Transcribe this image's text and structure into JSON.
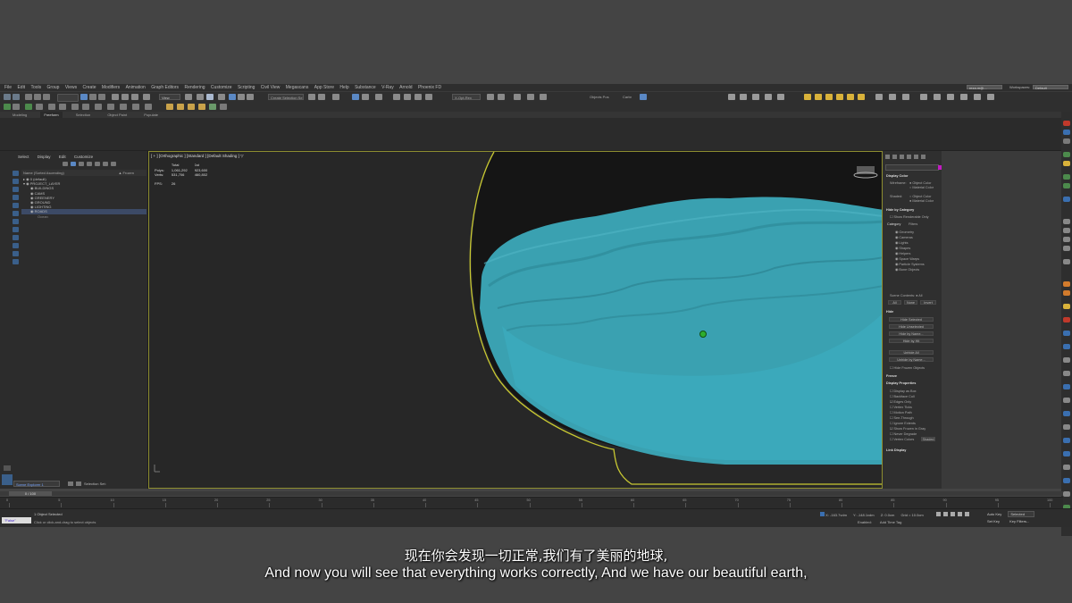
{
  "menu": [
    "File",
    "Edit",
    "Tools",
    "Group",
    "Views",
    "Create",
    "Modifiers",
    "Animation",
    "Graph Editors",
    "Rendering",
    "Customize",
    "Scripting",
    "Civil View",
    "Megascans",
    "App Store",
    "Help",
    "Substance",
    "V-Ray",
    "Arnold",
    "Phoenix FD"
  ],
  "workspace": {
    "user": "reza.m@...",
    "label": "Workspaces:",
    "value": "Default"
  },
  "toolbar": {
    "view_dropdown": "View",
    "selection_set": "Create Selection Se",
    "display_set": "X-Opt-Rex 2022",
    "objects_label": "Objects Pos",
    "context": "Carbr"
  },
  "ribbon_tabs": [
    "Modeling",
    "Freeform",
    "Selection",
    "Object Paint",
    "Populate"
  ],
  "ribbon_active": "Freeform",
  "scene_explorer": {
    "menu": [
      "Select",
      "Display",
      "Edit",
      "Customize"
    ],
    "col_name": "Name (Sorted Ascending)",
    "col_frozen": "▲ Frozen",
    "rows": [
      "0 (default)",
      "PROJECT_LAYER",
      "BUILDINGS",
      "CAMS",
      "GREENERY",
      "GROUND",
      "LIGHTING",
      "ROADS",
      "Ocean"
    ],
    "tab": "Scene Explorer 1",
    "selection_set": "Selection Set:"
  },
  "viewport": {
    "label": "[ + ] [Orthographic ] [Standard ] [Default Shading ]  ▽",
    "stats_headers": [
      "",
      "Total",
      "1st"
    ],
    "stats_polys": [
      "Polys:",
      "1,061,292",
      "923,600"
    ],
    "stats_verts": [
      "Verts:",
      "531,706",
      "460,802"
    ],
    "fps": [
      "FPS:",
      "26"
    ],
    "object_color": "#3aa3b3",
    "frame_color": "#c8c832"
  },
  "command_panel": {
    "display_color": "Display Color",
    "wireframe": "Wireframe:",
    "obj_color": "Object Color",
    "mat_color": "Material Color",
    "shaded": "Shaded:",
    "obj_color2": "Object Color",
    "mat_color2": "Material Color",
    "hide_by_cat": "Hide by Category",
    "show_renderable": "Show Renderable Only",
    "category": "Category",
    "filters": "Filters",
    "cats": [
      "Geometry",
      "Cameras",
      "Lights",
      "Shapes",
      "Helpers",
      "Space Warps",
      "Particle Systems",
      "Bone Objects"
    ],
    "scene_contents": "Scene Contents:",
    "all_label": "All",
    "btn_all": "All",
    "btn_none": "None",
    "btn_invert": "Invert",
    "hide": "Hide",
    "hide_btns": [
      "Hide Selected",
      "Hide Unselected",
      "Hide by Name...",
      "Hide by Hit",
      "Unhide All",
      "Unhide by Name..."
    ],
    "hide_frozen": "Hide Frozen Objects",
    "freeze": "Freeze",
    "display_props": "Display Properties",
    "props": [
      "Display as Box",
      "Backface Cull",
      "Edges Only",
      "Vertex Ticks",
      "Motion Path",
      "See-Through",
      "Ignore Extents",
      "Show Frozen in Gray",
      "Never Degrade",
      "Vertex Colors"
    ],
    "shaded_btn": "Shaded",
    "link_display": "Link Display"
  },
  "timeline": {
    "slider": "0 / 100",
    "ticks": [
      "0",
      "5",
      "10",
      "15",
      "20",
      "25",
      "30",
      "35",
      "40",
      "45",
      "50",
      "55",
      "60",
      "65",
      "70",
      "75",
      "80",
      "85",
      "90",
      "95",
      "100"
    ]
  },
  "status": {
    "maxscript": "\"False\"",
    "objects": "1 Object Selected",
    "hint": "Click or click-and-drag to select objects",
    "x": "X: -163.7vdm",
    "y": "Y: -148.1vdm",
    "z": "Z: 0.0cm",
    "grid": "Grid = 10.0cm",
    "enabled": "Enabled:",
    "add_time_tag": "Add Time Tag",
    "auto_key": "Auto Key",
    "selected": "Selected",
    "set_key": "Set Key",
    "key_filters": "Key Filters..."
  },
  "subtitle": {
    "cn": "现在你会发现一切正常,我们有了美丽的地球,",
    "en": "And now you will see that everything works correctly, And we have our beautiful earth,"
  }
}
